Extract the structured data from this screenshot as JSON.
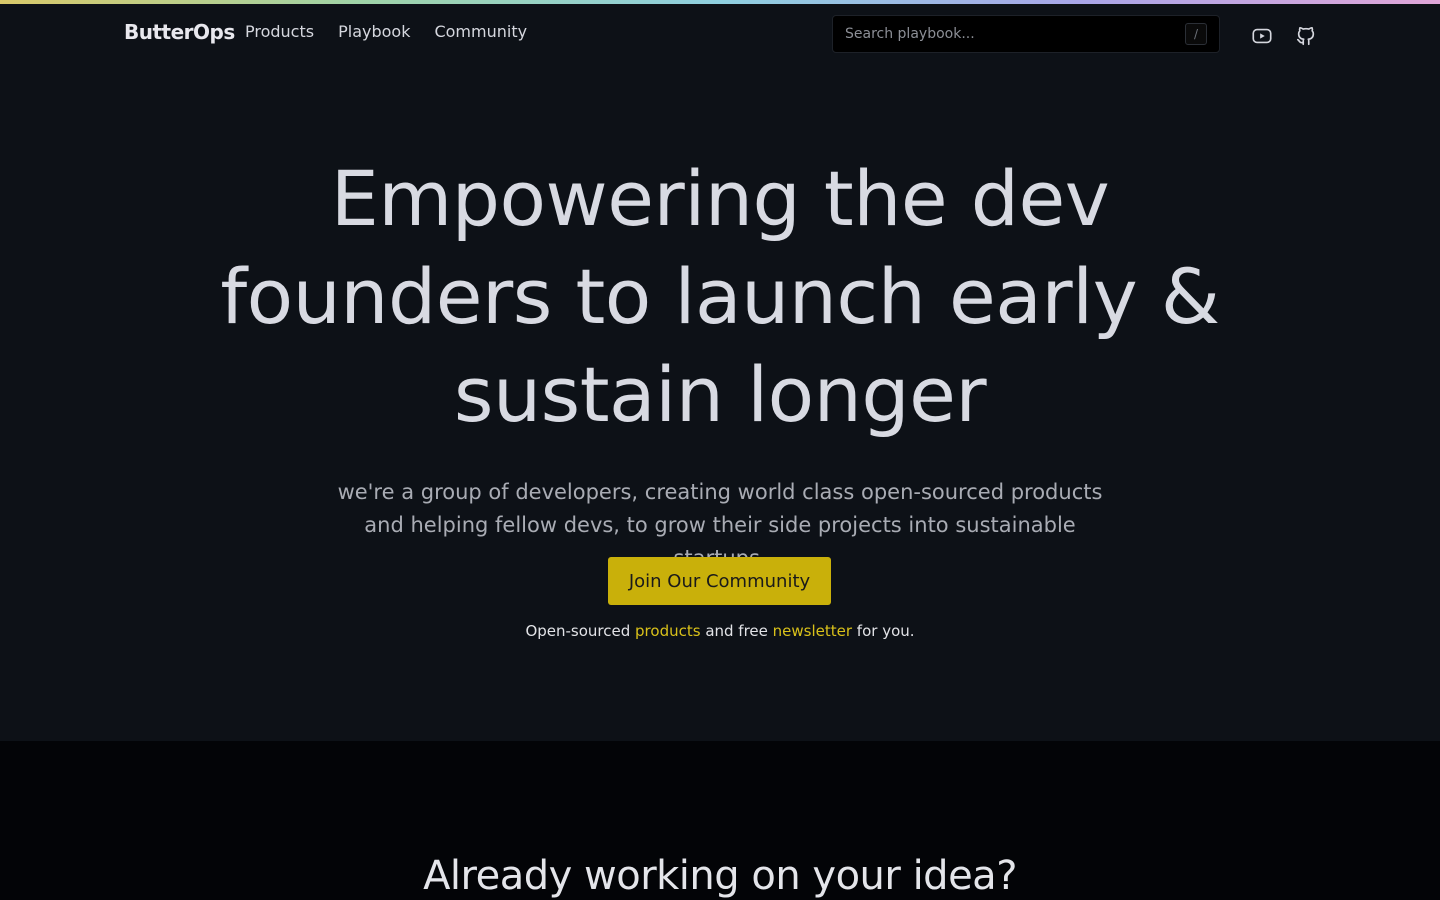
{
  "nav": {
    "brand": "ButterOps",
    "links": [
      "Products",
      "Playbook",
      "Community"
    ],
    "search_placeholder": "Search playbook...",
    "search_shortcut": "/",
    "icons": [
      "youtube-icon",
      "github-icon"
    ]
  },
  "hero": {
    "title": "Empowering the dev founders to launch early & sustain longer",
    "subtitle_line1": "we're a group of developers, creating world class open-sourced products",
    "subtitle_line2": "and helping fellow devs, to grow their side projects into sustainable startups.",
    "cta_label": "Join Our Community",
    "tagline_prefix": "Open-sourced ",
    "tagline_link1": "products",
    "tagline_middle": " and free ",
    "tagline_link2": "newsletter",
    "tagline_suffix": " for you."
  },
  "section2": {
    "heading": "Already working on your idea?"
  },
  "colors": {
    "background": "#0d1117",
    "accent": "#c9b00a",
    "link": "#d9c11a"
  }
}
